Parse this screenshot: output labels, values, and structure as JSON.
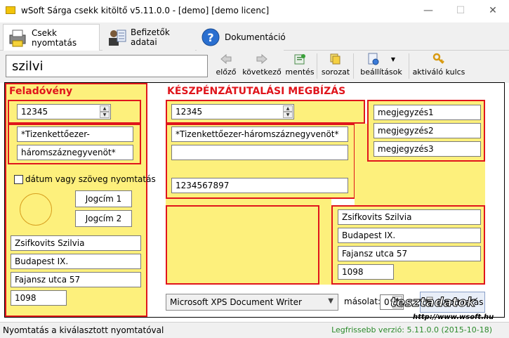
{
  "window": {
    "title": "wSoft Sárga csekk kitöltő v5.11.0.0 - [demo] [demo licenc]",
    "minimize": "—",
    "maximize": "☐",
    "close": "✕"
  },
  "tabs": [
    {
      "label": "Csekk nyomtatás"
    },
    {
      "label": "Befizetők adatai"
    },
    {
      "label": "Dokumentáció"
    }
  ],
  "search": {
    "value": "szilvi"
  },
  "toolbar": {
    "prev": "előző",
    "next": "következő",
    "save": "mentés",
    "series": "sorozat",
    "settings": "beállítások",
    "activate": "aktiváló kulcs"
  },
  "sender": {
    "heading": "Feladóvény",
    "amount": "12345",
    "amount_words_1": "*Tizenkettőezer-",
    "amount_words_2": "háromszáznegyvenöt*",
    "print_date_label": "dátum vagy szöveg nyomtatás",
    "title1": "Jogcím 1",
    "title2": "Jogcím 2",
    "name": "Zsifkovits Szilvia",
    "city": "Budapest IX.",
    "street": "Fajansz utca 57",
    "zip": "1098"
  },
  "transfer": {
    "heading": "KÉSZPÉNZÁTUTALÁSI MEGBÍZÁS",
    "amount": "12345",
    "amount_words": "*Tizenkettőezer-háromszáznegyvenöt*",
    "blank_line": "",
    "account": "1234567897",
    "notes": [
      "megjegyzés1",
      "megjegyzés2",
      "megjegyzés3"
    ],
    "name": "Zsifkovits Szilvia",
    "city": "Budapest IX.",
    "street": "Fajansz utca 57",
    "zip": "1098"
  },
  "printer": {
    "selected": "Microsoft XPS Document Writer",
    "copies_label": "másolat:",
    "copies_value": "0",
    "print_button": "Nyomtatás"
  },
  "watermark": {
    "text": "tesztadatok",
    "url": "http://www.wsoft.hu"
  },
  "status": {
    "left": "Nyomtatás a kiválasztott nyomtatóval",
    "right": "Legfrissebb verzió: 5.11.0.0 (2015-10-18)"
  }
}
